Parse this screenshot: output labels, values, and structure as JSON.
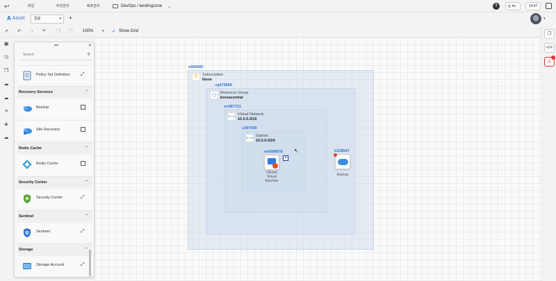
{
  "topbar": {
    "menu": [
      "파일",
      "버전관리",
      "배포관리"
    ],
    "path": "DevOps / landingzone",
    "help": "?",
    "lang": "ko",
    "time": "14:47"
  },
  "tabs_bar": {
    "brand": "Azure",
    "tab_select": "없음",
    "add": "+"
  },
  "toolbar": {
    "zoom": "100%",
    "show_grid_label": "Show Grid",
    "show_grid_checked": true
  },
  "palette": {
    "search_placeholder": "Search",
    "items_top": [
      {
        "label": "Policy Set Definition",
        "icon": "policy-icon",
        "action": "link"
      }
    ],
    "sections": [
      {
        "title": "Recovery Services",
        "items": [
          {
            "label": "Backup",
            "icon": "backup-icon",
            "action": "checkbox"
          },
          {
            "label": "Site Recovery",
            "icon": "site-recovery-icon",
            "action": "checkbox"
          }
        ]
      },
      {
        "title": "Redis Cache",
        "items": [
          {
            "label": "Redis Cache",
            "icon": "redis-icon",
            "action": "checkbox"
          }
        ]
      },
      {
        "title": "Security Center",
        "items": [
          {
            "label": "Security Center",
            "icon": "security-center-icon",
            "action": "link"
          }
        ]
      },
      {
        "title": "Sentinel",
        "items": [
          {
            "label": "Sentinel",
            "icon": "sentinel-icon",
            "action": "link"
          }
        ]
      },
      {
        "title": "Storage",
        "items": [
          {
            "label": "Storage Account",
            "icon": "storage-account-icon",
            "action": "link"
          }
        ]
      }
    ]
  },
  "diagram": {
    "subscription": {
      "id": "s456505",
      "type": "Subscription",
      "value": "None"
    },
    "resource_group": {
      "id": "rg475969",
      "type": "Resource Group",
      "value": "koreacentral"
    },
    "virtual_network": {
      "id": "vn387721",
      "type": "Virtual Network",
      "value": "10.0.0.0/16"
    },
    "subnet": {
      "id": "s397039",
      "type": "Subnet",
      "value": "10.0.0.0/24"
    },
    "vm": {
      "id": "vm566878",
      "label_lines": [
        "Ubuntu",
        "Virtual",
        "Machine"
      ]
    },
    "backup": {
      "id": "b318547",
      "label": "Backup"
    }
  },
  "colors": {
    "accent": "#2e6fd0",
    "warning": "#e33333"
  }
}
